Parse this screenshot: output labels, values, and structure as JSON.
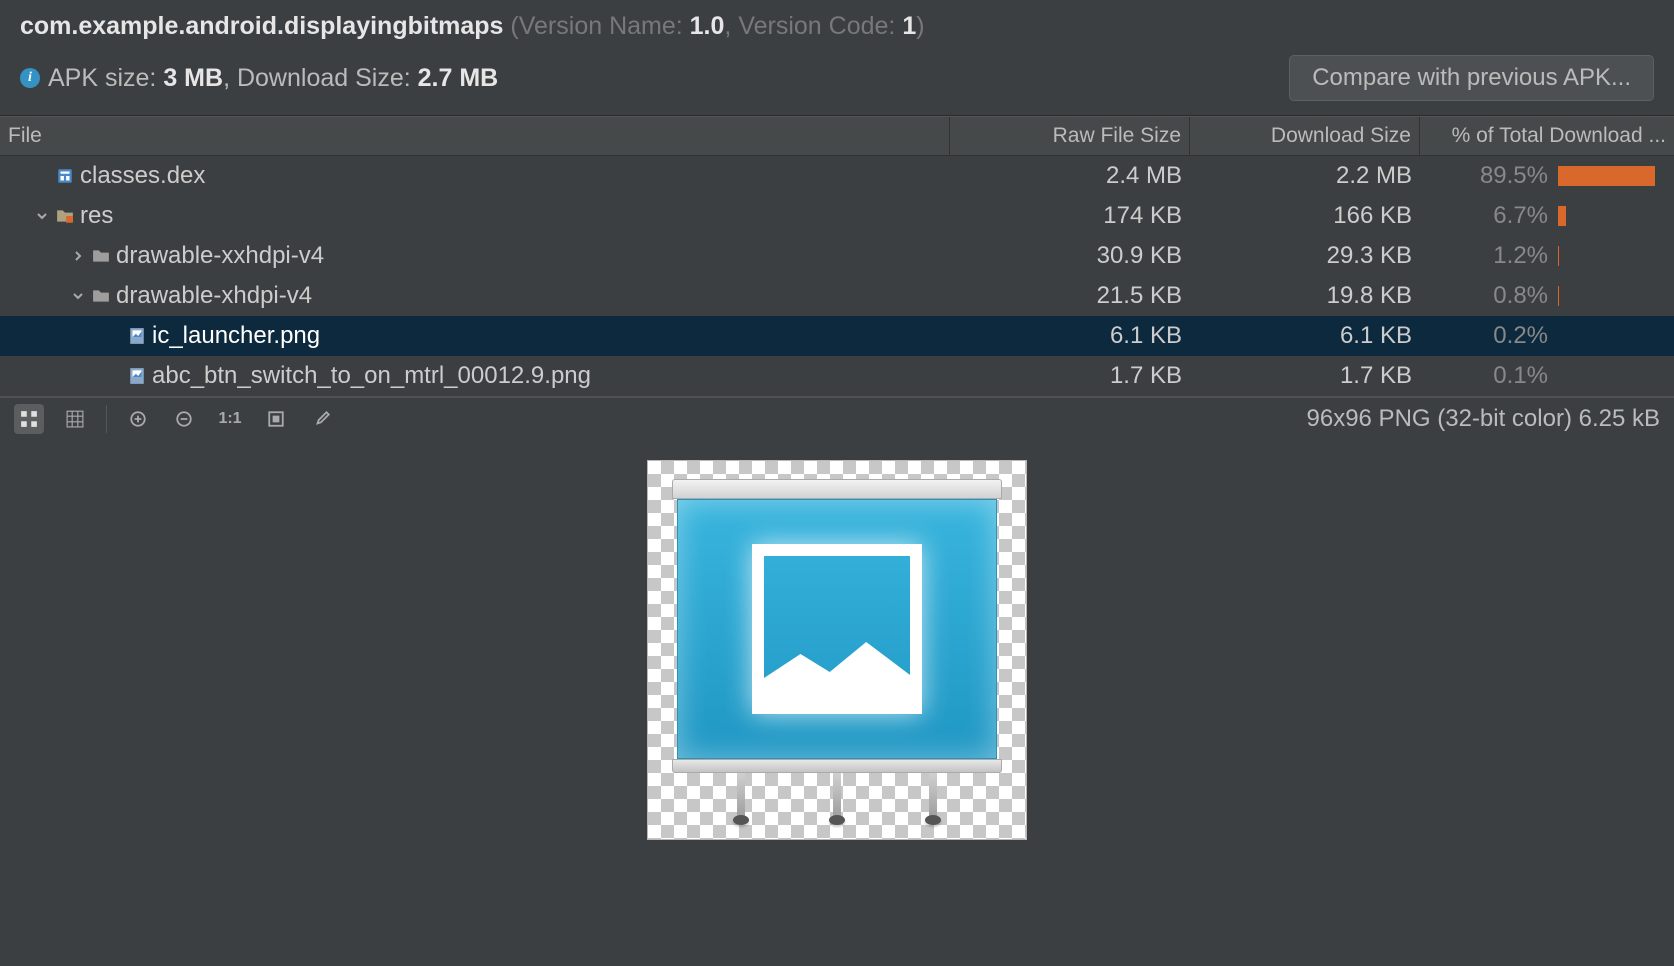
{
  "header": {
    "package": "com.example.android.displayingbitmaps",
    "version_name_label": "Version Name:",
    "version_name": "1.0",
    "version_code_label": "Version Code:",
    "version_code": "1",
    "apk_size_label": "APK size:",
    "apk_size": "3 MB",
    "download_size_label": "Download Size:",
    "download_size": "2.7 MB",
    "compare_button": "Compare with previous APK..."
  },
  "columns": {
    "file": "File",
    "raw": "Raw File Size",
    "download": "Download Size",
    "pct": "% of Total Download ..."
  },
  "rows": [
    {
      "indent": 0,
      "chevron": "",
      "icon": "dex",
      "name": "classes.dex",
      "raw": "2.4 MB",
      "download": "2.2 MB",
      "pct": "89.5%",
      "bar_pct": 89.5,
      "selected": false
    },
    {
      "indent": 0,
      "chevron": "down",
      "icon": "folder-res",
      "name": "res",
      "raw": "174 KB",
      "download": "166 KB",
      "pct": "6.7%",
      "bar_pct": 6.7,
      "selected": false
    },
    {
      "indent": 1,
      "chevron": "right",
      "icon": "folder",
      "name": "drawable-xxhdpi-v4",
      "raw": "30.9 KB",
      "download": "29.3 KB",
      "pct": "1.2%",
      "bar_pct": 1.2,
      "selected": false
    },
    {
      "indent": 1,
      "chevron": "down",
      "icon": "folder",
      "name": "drawable-xhdpi-v4",
      "raw": "21.5 KB",
      "download": "19.8 KB",
      "pct": "0.8%",
      "bar_pct": 0.8,
      "selected": false
    },
    {
      "indent": 2,
      "chevron": "",
      "icon": "png",
      "name": "ic_launcher.png",
      "raw": "6.1 KB",
      "download": "6.1 KB",
      "pct": "0.2%",
      "bar_pct": 0.2,
      "selected": true
    },
    {
      "indent": 2,
      "chevron": "",
      "icon": "png",
      "name": "abc_btn_switch_to_on_mtrl_00012.9.png",
      "raw": "1.7 KB",
      "download": "1.7 KB",
      "pct": "0.1%",
      "bar_pct": 0.1,
      "selected": false
    }
  ],
  "preview": {
    "info": "96x96 PNG (32-bit color) 6.25 kB"
  }
}
